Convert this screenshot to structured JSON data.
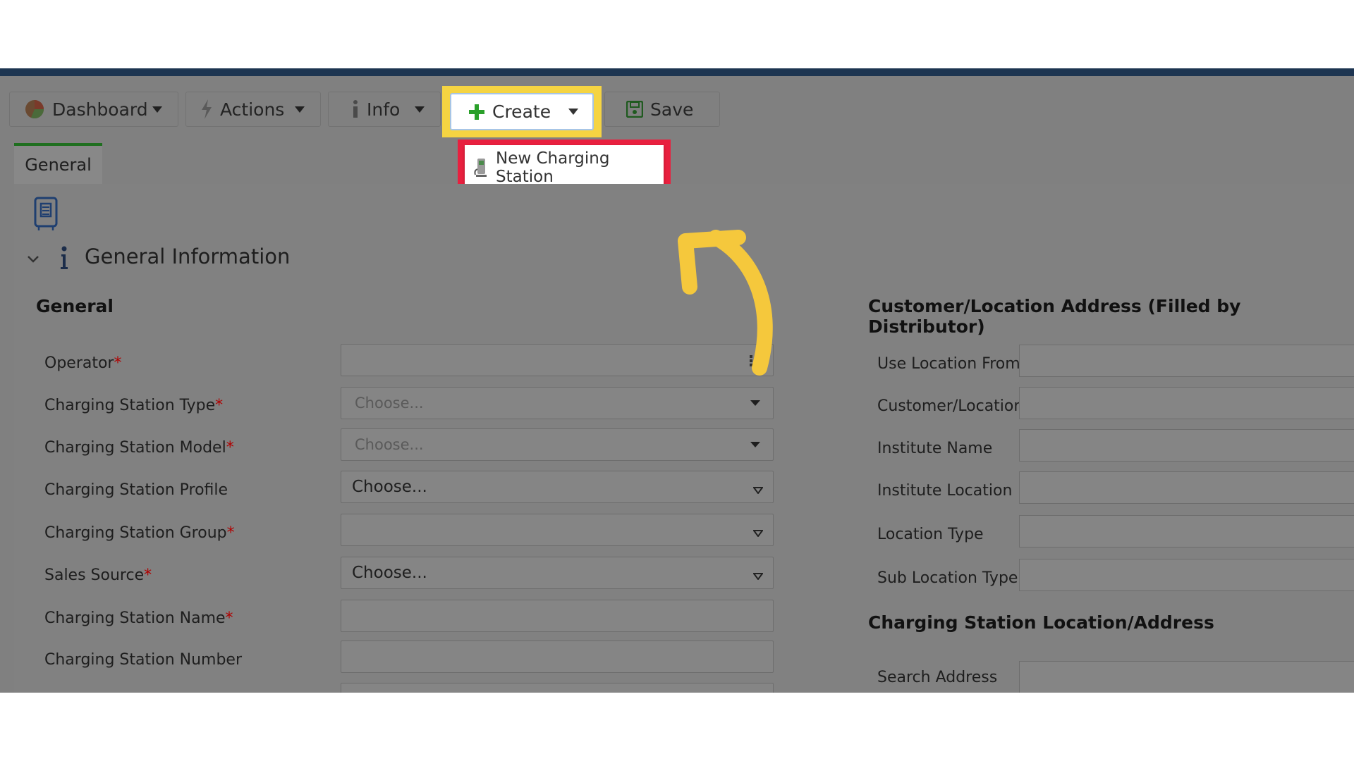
{
  "toolbar": {
    "dashboard_label": "Dashboard",
    "actions_label": "Actions",
    "info_label": "Info",
    "create_label": "Create",
    "save_label": "Save"
  },
  "create_menu": {
    "items": [
      {
        "label": "New Charging Station",
        "icon": "charging-station-icon"
      }
    ]
  },
  "tabs": [
    {
      "label": "General",
      "active": true
    }
  ],
  "section": {
    "title": "General Information"
  },
  "left_column": {
    "heading": "General",
    "fields": [
      {
        "label": "Operator",
        "required": true,
        "type": "lookup",
        "value": ""
      },
      {
        "label": "Charging Station Type",
        "required": true,
        "type": "select",
        "placeholder": "Choose..."
      },
      {
        "label": "Charging Station Model",
        "required": true,
        "type": "select",
        "placeholder": "Choose..."
      },
      {
        "label": "Charging Station Profile",
        "required": false,
        "type": "select",
        "value": "Choose..."
      },
      {
        "label": "Charging Station Group",
        "required": true,
        "type": "select",
        "value": ""
      },
      {
        "label": "Sales Source",
        "required": true,
        "type": "select",
        "value": "Choose..."
      },
      {
        "label": "Charging Station Name",
        "required": true,
        "type": "text",
        "value": ""
      },
      {
        "label": "Charging Station Number",
        "required": false,
        "type": "text",
        "value": ""
      }
    ]
  },
  "right_column": {
    "heading": "Customer/Location Address (Filled by Distributor)",
    "fields": [
      {
        "label": "Use Location From"
      },
      {
        "label": "Customer/Location"
      },
      {
        "label": "Institute Name"
      },
      {
        "label": "Institute Location"
      },
      {
        "label": "Location Type"
      },
      {
        "label": "Sub Location Type"
      }
    ],
    "heading2": "Charging Station Location/Address",
    "fields2": [
      {
        "label": "Search Address"
      }
    ]
  },
  "colors": {
    "highlight_create": "#f5d442",
    "highlight_menu": "#e8203f",
    "arrow": "#f5c83c",
    "top_bar": "#1d3551",
    "required_mark": "#b00000"
  },
  "required_mark": "*"
}
